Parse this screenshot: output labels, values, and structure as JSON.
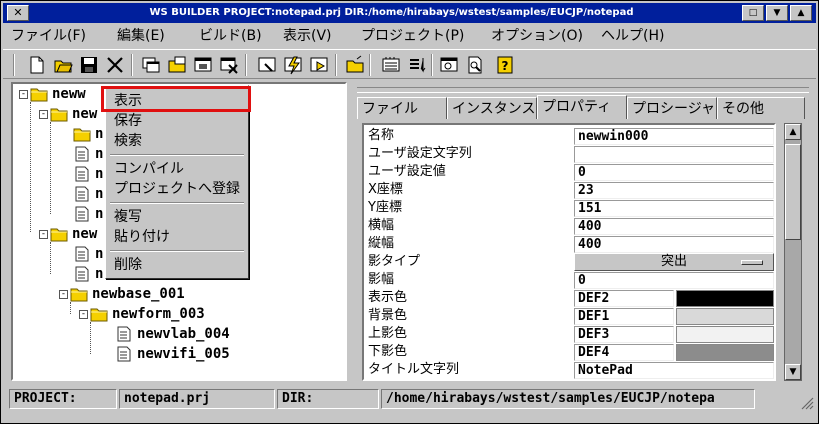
{
  "titlebar": {
    "title": "WS BUILDER PROJECT:notepad.prj DIR:/home/hirabays/wstest/samples/EUCJP/notepad",
    "sys_glyph": "✕",
    "btn1": "□",
    "btn2": "▼",
    "btn3": "▲"
  },
  "menubar": {
    "file": "ファイル(F)",
    "edit": "編集(E)",
    "build": "ビルド(B)",
    "view": "表示(V)",
    "project": "プロジェクト(P)",
    "option": "オプション(O)",
    "help": "ヘルプ(H)"
  },
  "toolbar": {
    "icons": [
      "new-file-icon",
      "open-folder-icon",
      "save-icon",
      "cut-icon",
      "new-window-icon",
      "open-window-icon",
      "window-icon",
      "close-window-icon",
      "inspect-icon",
      "build-icon",
      "run-icon",
      "open-icon",
      "list-icon",
      "sort-icon",
      "window-view-icon",
      "print-preview-icon",
      "help-icon"
    ]
  },
  "tree": {
    "nodes": [
      {
        "label": "neww"
      },
      {
        "label": "new"
      },
      {
        "label": "n"
      },
      {
        "label": "n"
      },
      {
        "label": "n"
      },
      {
        "label": "n"
      },
      {
        "label": "n"
      },
      {
        "label": "new"
      },
      {
        "label": "n"
      },
      {
        "label": "n"
      },
      {
        "label": "newbase_001"
      },
      {
        "label": "newform_003"
      },
      {
        "label": "newvlab_004"
      },
      {
        "label": "newvifi_005"
      }
    ]
  },
  "context_menu": {
    "show": "表示",
    "save": "保存",
    "search": "検索",
    "compile": "コンパイル",
    "register": "プロジェクトへ登録",
    "copy": "複写",
    "paste": "貼り付け",
    "delete": "削除"
  },
  "tabs": {
    "file": "ファイル",
    "instance": "インスタンス",
    "property": "プロパティ",
    "procedure": "プロシージャ",
    "other": "その他"
  },
  "properties": {
    "name": {
      "label": "名称",
      "value": "newwin000"
    },
    "user_str": {
      "label": "ユーザ設定文字列",
      "value": ""
    },
    "user_val": {
      "label": "ユーザ設定値",
      "value": "0"
    },
    "x": {
      "label": "X座標",
      "value": "23"
    },
    "y": {
      "label": "Y座標",
      "value": "151"
    },
    "width": {
      "label": "横幅",
      "value": "400"
    },
    "height": {
      "label": "縦幅",
      "value": "400"
    },
    "shadow_type": {
      "label": "影タイプ",
      "value": "突出"
    },
    "shadow_width": {
      "label": "影幅",
      "value": "0"
    },
    "fg_color": {
      "label": "表示色",
      "value": "DEF2",
      "swatch": "#000000"
    },
    "bg_color": {
      "label": "背景色",
      "value": "DEF1",
      "swatch": "#d9d9d9"
    },
    "top_shadow": {
      "label": "上影色",
      "value": "DEF3",
      "swatch": "#f2f2f2"
    },
    "bottom_shadow": {
      "label": "下影色",
      "value": "DEF4",
      "swatch": "#8c8c8c"
    },
    "title_str": {
      "label": "タイトル文字列",
      "value": "NotePad"
    }
  },
  "status": {
    "project_label": "PROJECT:",
    "project_value": "notepad.prj",
    "dir_label": "DIR:",
    "dir_value": "/home/hirabays/wstest/samples/EUCJP/notepa"
  },
  "colors": {
    "titlebar": "#001f9c",
    "panel": "#c6c6c6",
    "highlight": "#e01010",
    "folder": "#f5d000"
  }
}
